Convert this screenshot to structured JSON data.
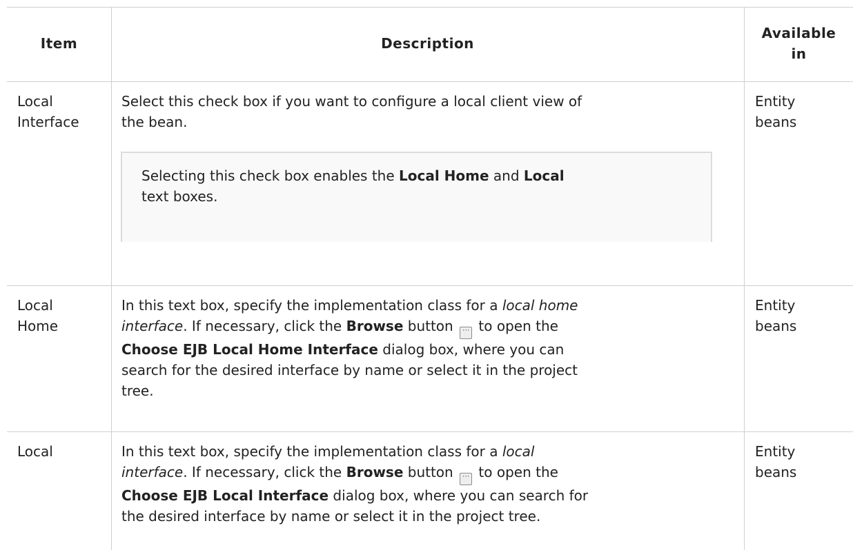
{
  "table": {
    "headers": {
      "item": "Item",
      "description": "Description",
      "available_line1": "Available",
      "available_line2": "in"
    },
    "rows": [
      {
        "item_line1": "Local",
        "item_line2": "Interface",
        "desc_line1": "Select this check box if you want to configure a local client view of",
        "desc_line2": "the bean.",
        "note": {
          "pre": "Selecting this check box enables the ",
          "b1": "Local Home",
          "mid": " and ",
          "b2": "Local",
          "post": "text boxes."
        },
        "available_line1": "Entity",
        "available_line2": "beans"
      },
      {
        "item_line1": "Local",
        "item_line2": "Home",
        "desc": {
          "l1_pre": "In this text box, specify the implementation class for a ",
          "l1_italic": "local home",
          "l2_italic": "interface",
          "l2_pre": ". If necessary, click the ",
          "l2_bold": "Browse",
          "l2_post1": " button ",
          "l2_post2": " to open the",
          "l3_bold": "Choose EJB Local Home Interface",
          "l3_post": " dialog box, where you can",
          "l4": "search for the desired interface by name or select it in the project",
          "l5": "tree."
        },
        "available_line1": "Entity",
        "available_line2": "beans"
      },
      {
        "item_line1": "Local",
        "desc": {
          "l1_pre": "In this text box, specify the implementation class for a ",
          "l1_italic": "local",
          "l2_italic": "interface",
          "l2_pre": ". If necessary, click the ",
          "l2_bold": "Browse",
          "l2_post1": " button ",
          "l2_post2": " to open the",
          "l3_bold": "Choose EJB Local Interface",
          "l3_post": " dialog box, where you can search for",
          "l4": "the desired interface by name or select it in the project tree."
        },
        "available_line1": "Entity",
        "available_line2": "beans"
      }
    ]
  },
  "icons": {
    "browse": "ellipsis-button-icon"
  }
}
